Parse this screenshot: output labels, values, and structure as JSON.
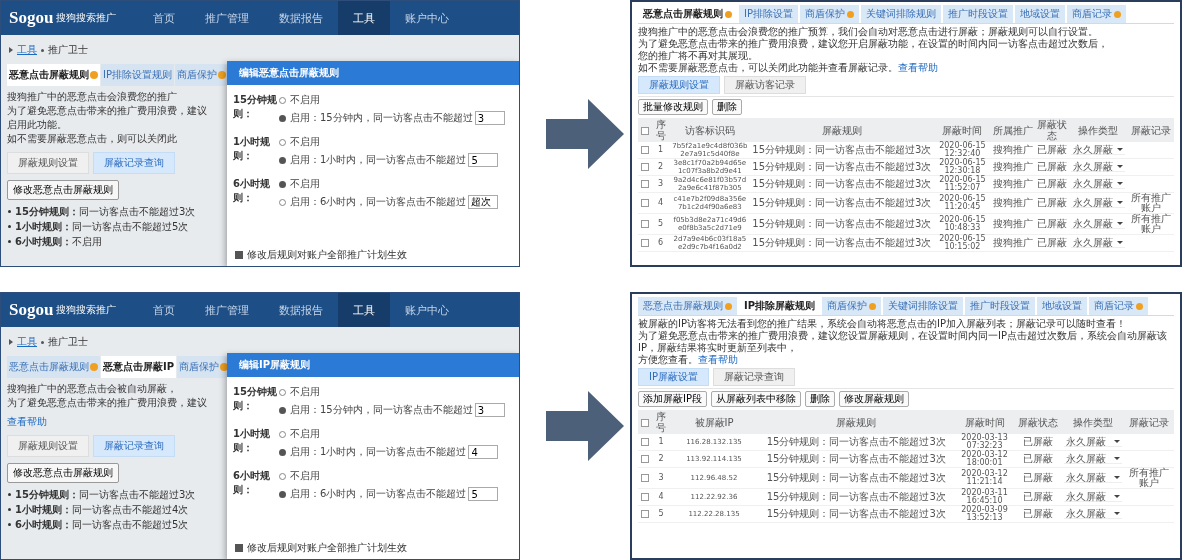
{
  "panels": [
    {
      "kind": "settings",
      "logo": "Sogou",
      "product": "搜狗搜索推广",
      "nav": [
        {
          "label": "首页",
          "selected": false
        },
        {
          "label": "推广管理",
          "selected": false
        },
        {
          "label": "数据报告",
          "selected": false
        },
        {
          "label": "工具",
          "selected": true
        },
        {
          "label": "账户中心",
          "selected": false
        }
      ],
      "breadcrumb": [
        "工具",
        "推广卫士"
      ],
      "tabs": [
        {
          "label": "恶意点击屏蔽规则",
          "badge": true,
          "selected": true
        },
        {
          "label": "IP排除设置规则",
          "badge": false,
          "selected": false
        },
        {
          "label": "商盾保护",
          "badge": true,
          "selected": false
        }
      ],
      "paragraph": [
        "搜狗推广中的恶意点击会浪费您的推广",
        "为了避免恶意点击带来的推广费用浪费，建议",
        "启用此功能。",
        "如不需要屏蔽恶意点击，则可以关闭此"
      ],
      "subtabs": [
        {
          "label": "屏蔽规则设置",
          "selected": false
        },
        {
          "label": "屏蔽记录查询",
          "selected": true
        }
      ],
      "button": "修改恶意点击屏蔽规则",
      "bullets": [
        {
          "label": "15分钟规则：",
          "text": "同一访客点击不能超过3次"
        },
        {
          "label": "1小时规则：",
          "text": "同一访客点击不能超过5次"
        },
        {
          "label": "6小时规则：",
          "text": "不启用"
        }
      ],
      "dialog": {
        "title": "编辑恶意点击屏蔽规则",
        "rules": [
          {
            "label": "15分钟规则：",
            "off": "不启用",
            "on": "启用：15分钟内，同一访客点击不能超过",
            "enabled": true,
            "value": "3"
          },
          {
            "label": "1小时规则：",
            "off": "不启用",
            "on": "启用：1小时内，同一访客点击不能超过",
            "enabled": true,
            "value": "5"
          },
          {
            "label": "6小时规则：",
            "off": "不启用",
            "on": "启用：6小时内，同一访客点击不能超过",
            "enabled": false,
            "value": "超次"
          }
        ],
        "apply": {
          "label": "修改后规则对账户全部推广计划生效",
          "checked": true
        }
      }
    },
    {
      "kind": "table",
      "tabs": [
        {
          "label": "恶意点击屏蔽规则",
          "badge": true,
          "selected": true
        },
        {
          "label": "IP排除设置",
          "badge": false,
          "selected": false
        },
        {
          "label": "商盾保护",
          "badge": true,
          "selected": false
        },
        {
          "label": "关键词排除规则",
          "badge": false,
          "selected": false
        },
        {
          "label": "推广时段设置",
          "badge": false,
          "selected": false
        },
        {
          "label": "地域设置",
          "badge": false,
          "selected": false
        },
        {
          "label": "商盾记录",
          "badge": true,
          "selected": false
        }
      ],
      "paragraph": [
        "搜狗推广中的恶意点击会浪费您的推广预算，我们会自动对恶意点击进行屏蔽；屏蔽规则可以自行设置。",
        "为了避免恶意点击带来的推广费用浪费，建议您开启屏蔽功能，在设置的时间内同一访客点击超过次数后，",
        "您的推广将不再对其展现。",
        "如不需要屏蔽恶意点击，可以关闭此功能并查看屏蔽记录。"
      ],
      "link": "查看帮助",
      "subtabs": [
        {
          "label": "屏蔽规则设置",
          "selected": true
        },
        {
          "label": "屏蔽访客记录",
          "selected": false
        }
      ],
      "buttons": [
        "批量修改规则",
        "删除"
      ],
      "columns": [
        {
          "label": "序号",
          "kind": "seq"
        },
        {
          "label": "访客标识码",
          "kind": "id"
        },
        {
          "label": "屏蔽规则",
          "kind": "rule"
        },
        {
          "label": "屏蔽时间",
          "kind": "time"
        },
        {
          "label": "所属推广",
          "kind": "text"
        },
        {
          "label": "屏蔽状态",
          "kind": "text"
        },
        {
          "label": "操作类型",
          "kind": "select"
        },
        {
          "label": "屏蔽记录",
          "kind": "note"
        }
      ],
      "select_all": {
        "checked": false
      },
      "rows": [
        {
          "checked": false,
          "cells": [
            "1",
            "7b5f2a1e9c4d8f036b2e7a91c5d40f8e",
            "15分钟规则：同一访客点击不能超过3次",
            "2020-06-15 12:32:40",
            "搜狗推广",
            "已屏蔽",
            "永久屏蔽"
          ]
        },
        {
          "checked": false,
          "cells": [
            "2",
            "3e8c1f70a2b94d65e1c07f3a8b2d9e41",
            "15分钟规则：同一访客点击不能超过3次",
            "2020-06-15 12:30:18",
            "搜狗推广",
            "已屏蔽",
            "永久屏蔽"
          ]
        },
        {
          "checked": false,
          "cells": [
            "3",
            "9a2d4c6e81f03b57d2a9e6c41f87b305",
            "15分钟规则：同一访客点击不能超过3次",
            "2020-06-15 11:52:07",
            "搜狗推广",
            "已屏蔽",
            "永久屏蔽"
          ]
        },
        {
          "checked": false,
          "cells": [
            "4",
            "c41e7b2f09d8a356e7b1c2d4f90a6e83",
            "15分钟规则：同一访客点击不能超过3次",
            "2020-06-15 11:20:45",
            "搜狗推广",
            "已屏蔽",
            "永久屏蔽",
            "所有推广账户"
          ]
        },
        {
          "checked": false,
          "cells": [
            "5",
            "f05b3d8e2a71c49d6e0f8b3a5c2d71e9",
            "15分钟规则：同一访客点击不能超过3次",
            "2020-06-15 10:48:33",
            "搜狗推广",
            "已屏蔽",
            "永久屏蔽",
            "所有推广账户"
          ]
        },
        {
          "checked": false,
          "cells": [
            "6",
            "2d7a9e4b6c03f18a5e2d9c7b4f16a0d2",
            "15分钟规则：同一访客点击不能超过3次",
            "2020-06-15 10:15:02",
            "搜狗推广",
            "已屏蔽",
            "永久屏蔽"
          ]
        }
      ]
    },
    {
      "kind": "settings",
      "logo": "Sogou",
      "product": "搜狗搜索推广",
      "nav": [
        {
          "label": "首页",
          "selected": false
        },
        {
          "label": "推广管理",
          "selected": false
        },
        {
          "label": "数据报告",
          "selected": false
        },
        {
          "label": "工具",
          "selected": true
        },
        {
          "label": "账户中心",
          "selected": false
        }
      ],
      "breadcrumb": [
        "工具",
        "推广卫士"
      ],
      "tabs": [
        {
          "label": "恶意点击屏蔽规则",
          "badge": true,
          "selected": false
        },
        {
          "label": "恶意点击屏蔽IP",
          "badge": false,
          "selected": true
        },
        {
          "label": "商盾保护",
          "badge": true,
          "selected": false
        }
      ],
      "paragraph": [
        "搜狗推广中的恶意点击会被自动屏蔽，",
        "为了避免恶意点击带来的推广费用浪费，建议"
      ],
      "link": "查看帮助",
      "subtabs": [
        {
          "label": "屏蔽规则设置",
          "selected": false
        },
        {
          "label": "屏蔽记录查询",
          "selected": true
        }
      ],
      "button": "修改恶意点击屏蔽规则",
      "bullets": [
        {
          "label": "15分钟规则：",
          "text": "同一访客点击不能超过3次"
        },
        {
          "label": "1小时规则：",
          "text": "同一访客点击不能超过4次"
        },
        {
          "label": "6小时规则：",
          "text": "同一访客点击不能超过5次"
        }
      ],
      "dialog": {
        "title": "编辑IP屏蔽规则",
        "rules": [
          {
            "label": "15分钟规则：",
            "off": "不启用",
            "on": "启用：15分钟内，同一访客点击不能超过",
            "enabled": true,
            "value": "3"
          },
          {
            "label": "1小时规则：",
            "off": "不启用",
            "on": "启用：1小时内，同一访客点击不能超过",
            "enabled": true,
            "value": "4"
          },
          {
            "label": "6小时规则：",
            "off": "不启用",
            "on": "启用：6小时内，同一访客点击不能超过",
            "enabled": true,
            "value": "5"
          }
        ],
        "apply": {
          "label": "修改后规则对账户全部推广计划生效",
          "checked": true
        }
      }
    },
    {
      "kind": "table",
      "tabs": [
        {
          "label": "恶意点击屏蔽规则",
          "badge": true,
          "selected": false
        },
        {
          "label": "IP排除屏蔽规则",
          "badge": false,
          "selected": true
        },
        {
          "label": "商盾保护",
          "badge": true,
          "selected": false
        },
        {
          "label": "关键词排除设置",
          "badge": false,
          "selected": false
        },
        {
          "label": "推广时段设置",
          "badge": false,
          "selected": false
        },
        {
          "label": "地域设置",
          "badge": false,
          "selected": false
        },
        {
          "label": "商盾记录",
          "badge": true,
          "selected": false
        }
      ],
      "paragraph": [
        "被屏蔽的IP访客将无法看到您的推广结果，系统会自动将恶意点击的IP加入屏蔽列表；屏蔽记录可以随时查看！",
        "为了避免恶意点击带来的推广费用浪费，建议您设置屏蔽规则，在设置时间内同一IP点击超过次数后，系统会自动屏蔽该IP，屏蔽结果将实时更新至列表中，",
        "方便您查看。"
      ],
      "link": "查看帮助",
      "subtabs": [
        {
          "label": "IP屏蔽设置",
          "selected": true
        },
        {
          "label": "屏蔽记录查询",
          "selected": false
        }
      ],
      "buttons": [
        "添加屏蔽IP段",
        "从屏蔽列表中移除",
        "删除",
        "修改屏蔽规则"
      ],
      "columns": [
        {
          "label": "序号",
          "kind": "seq"
        },
        {
          "label": "被屏蔽IP",
          "kind": "id"
        },
        {
          "label": "屏蔽规则",
          "kind": "rule"
        },
        {
          "label": "屏蔽时间",
          "kind": "time"
        },
        {
          "label": "屏蔽状态",
          "kind": "text"
        },
        {
          "label": "操作类型",
          "kind": "select"
        },
        {
          "label": "屏蔽记录",
          "kind": "note"
        }
      ],
      "select_all": {
        "checked": false
      },
      "rows": [
        {
          "checked": false,
          "cells": [
            "1",
            "116.28.132.135",
            "15分钟规则：同一访客点击不能超过3次",
            "2020-03-13 07:32:23",
            "已屏蔽",
            "永久屏蔽"
          ]
        },
        {
          "checked": false,
          "cells": [
            "2",
            "113.92.114.135",
            "15分钟规则：同一访客点击不能超过3次",
            "2020-03-12 18:00:01",
            "已屏蔽",
            "永久屏蔽"
          ]
        },
        {
          "checked": false,
          "cells": [
            "3",
            "112.96.48.52",
            "15分钟规则：同一访客点击不能超过3次",
            "2020-03-12 11:21:14",
            "已屏蔽",
            "永久屏蔽",
            "所有推广账户"
          ]
        },
        {
          "checked": false,
          "cells": [
            "4",
            "112.22.92.36",
            "15分钟规则：同一访客点击不能超过3次",
            "2020-03-11 16:45:10",
            "已屏蔽",
            "永久屏蔽"
          ]
        },
        {
          "checked": false,
          "cells": [
            "5",
            "112.22.28.135",
            "15分钟规则：同一访客点击不能超过3次",
            "2020-03-09 13:52:13",
            "已屏蔽",
            "永久屏蔽"
          ]
        }
      ]
    }
  ]
}
